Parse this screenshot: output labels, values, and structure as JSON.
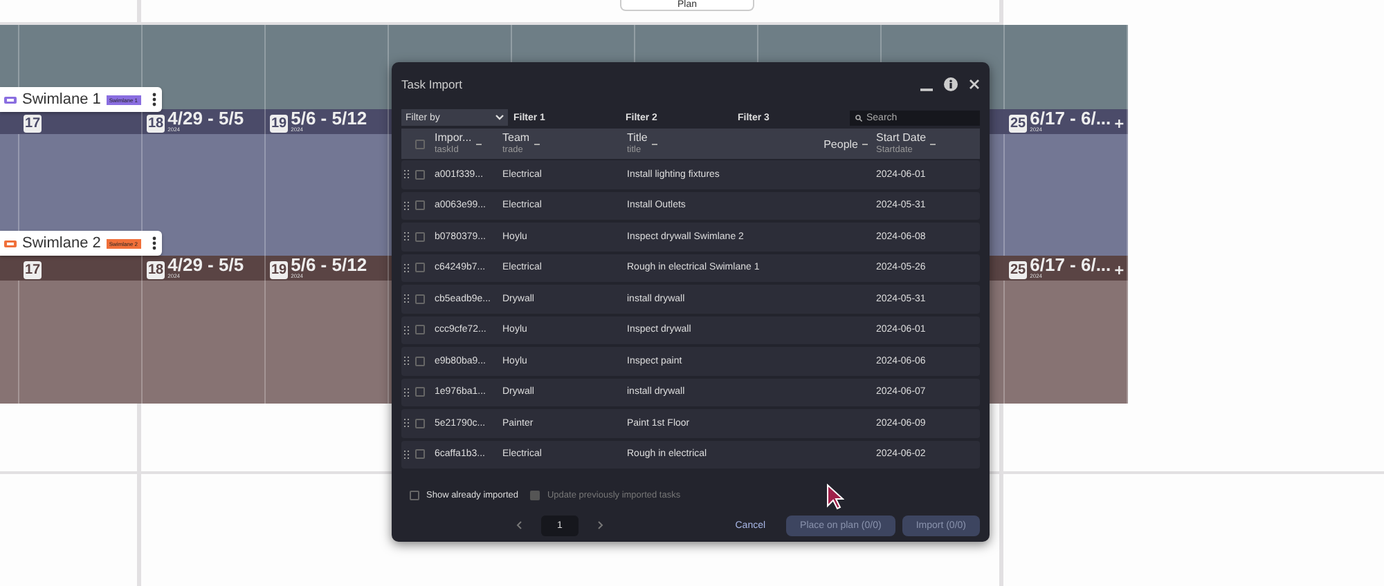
{
  "top_bar": {
    "label": "Plan"
  },
  "swimlanes": [
    {
      "name": "Swimlane 1",
      "tag": "Swimlane 1",
      "color": "#8a6ee0",
      "weeks": [
        {
          "number": "17"
        },
        {
          "number": "18",
          "range": "4/29 - 5/5",
          "year": "2024"
        },
        {
          "number": "19",
          "range": "5/6 - 5/12",
          "year": "2024"
        },
        {
          "number": "25",
          "range": "6/17 - 6/...",
          "year": "2024"
        }
      ]
    },
    {
      "name": "Swimlane 2",
      "tag": "Swimlane 2",
      "color": "#f0703a",
      "weeks": [
        {
          "number": "17"
        },
        {
          "number": "18",
          "range": "4/29 - 5/5",
          "year": "2024"
        },
        {
          "number": "19",
          "range": "5/6 - 5/12",
          "year": "2024"
        },
        {
          "number": "25",
          "range": "6/17 - 6/...",
          "year": "2024"
        }
      ]
    }
  ],
  "dialog": {
    "title": "Task Import",
    "filter_by": "Filter by",
    "filters": [
      "Filter 1",
      "Filter 2",
      "Filter 3"
    ],
    "search": {
      "placeholder": "Search"
    },
    "all_checked": false,
    "columns": [
      {
        "label": "Impor...",
        "sub": "taskId"
      },
      {
        "label": "Team",
        "sub": "trade"
      },
      {
        "label": "Title",
        "sub": "title"
      },
      {
        "label": "People"
      },
      {
        "label": "Start Date",
        "sub": "Startdate"
      }
    ],
    "rows": [
      {
        "id": "a001f339...",
        "team": "Electrical",
        "title": "Install lighting fixtures",
        "start": "2024-06-01",
        "checked": false
      },
      {
        "id": "a0063e99...",
        "team": "Electrical",
        "title": "Install Outlets",
        "start": "2024-05-31",
        "checked": false
      },
      {
        "id": "b0780379...",
        "team": "Hoylu",
        "title": "Inspect drywall Swimlane 2",
        "start": "2024-06-08",
        "checked": false
      },
      {
        "id": "c64249b7...",
        "team": "Electrical",
        "title": "Rough in electrical Swimlane 1",
        "start": "2024-05-26",
        "checked": false
      },
      {
        "id": "cb5eadb9e...",
        "team": "Drywall",
        "title": "install drywall",
        "start": "2024-05-31",
        "checked": false
      },
      {
        "id": "ccc9cfe72...",
        "team": "Hoylu",
        "title": "Inspect drywall",
        "start": "2024-06-01",
        "checked": false
      },
      {
        "id": "e9b80ba9...",
        "team": "Hoylu",
        "title": "Inspect paint",
        "start": "2024-06-06",
        "checked": false
      },
      {
        "id": "1e976ba1...",
        "team": "Drywall",
        "title": "install drywall",
        "start": "2024-06-07",
        "checked": false
      },
      {
        "id": "5e21790c...",
        "team": "Painter",
        "title": "Paint 1st Floor",
        "start": "2024-06-09",
        "checked": false
      },
      {
        "id": "6caffa1b3...",
        "team": "Electrical",
        "title": "Rough in electrical",
        "start": "2024-06-02",
        "checked": false
      }
    ],
    "options": [
      {
        "label": "Show already imported",
        "checked": false,
        "disabled": false
      },
      {
        "label": "Update previously imported tasks",
        "checked": false,
        "disabled": true
      }
    ],
    "page": "1",
    "buttons": [
      {
        "label": "Cancel",
        "kind": "link",
        "disabled": false
      },
      {
        "label": "Place on plan (0/0)",
        "kind": "filled",
        "disabled": true
      },
      {
        "label": "Import (0/0)",
        "kind": "filled",
        "disabled": true
      }
    ]
  }
}
